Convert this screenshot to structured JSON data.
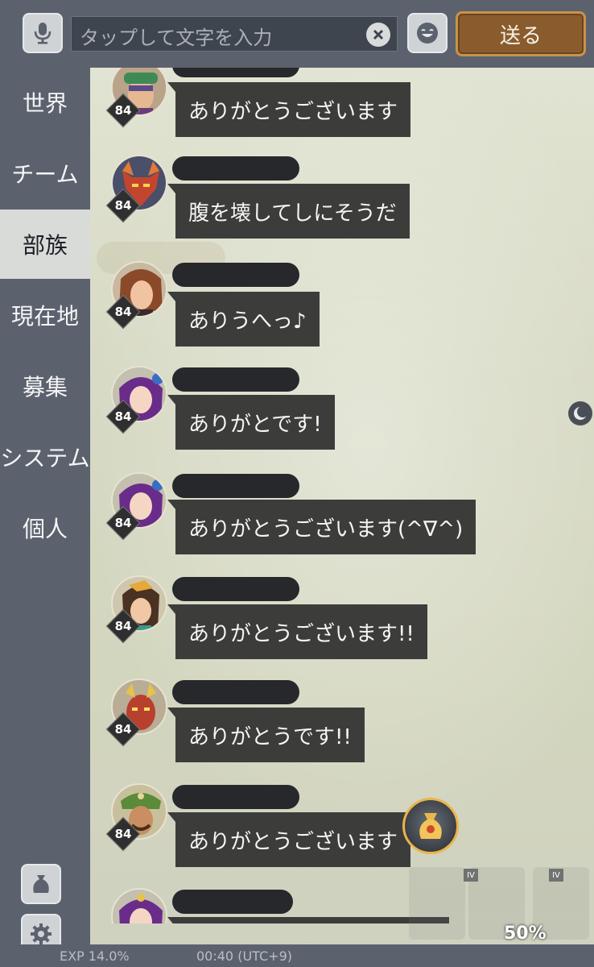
{
  "header": {
    "input_placeholder": "タップして文字を入力",
    "send_label": "送る"
  },
  "sidebar": {
    "tabs": [
      {
        "label": "世界"
      },
      {
        "label": "チーム"
      },
      {
        "label": "部族",
        "active": true
      },
      {
        "label": "現在地"
      },
      {
        "label": "募集"
      },
      {
        "label": "システム"
      },
      {
        "label": "個人"
      }
    ]
  },
  "messages": [
    {
      "level": "84",
      "text": "ありがとうございます",
      "avatar": "green-helmet-avatar"
    },
    {
      "level": "84",
      "text": "腹を壊してしにそうだ",
      "avatar": "red-demon-mask-avatar"
    },
    {
      "level": "84",
      "text": "ありうへっ♪",
      "avatar": "brown-hair-girl-avatar"
    },
    {
      "level": "84",
      "text": "ありがとです!",
      "avatar": "purple-hair-girl-avatar"
    },
    {
      "level": "84",
      "text": "ありがとうございます(^∇^)",
      "avatar": "purple-hair-girl-avatar"
    },
    {
      "level": "84",
      "text": "ありがとうございます!!",
      "avatar": "bird-hat-girl-avatar"
    },
    {
      "level": "84",
      "text": "ありがとうです!!",
      "avatar": "red-horned-warrior-avatar"
    },
    {
      "level": "84",
      "text": "ありがとうございます",
      "avatar": "green-hat-warrior-avatar"
    },
    {
      "level": "",
      "text": "",
      "avatar": "purple-hair-girl-avatar"
    }
  ],
  "status": {
    "exp": "EXP 14.0%",
    "time": "00:40 (UTC+9)",
    "percent": "50%"
  },
  "colors": {
    "panel": "#5b626e",
    "bubble": "#3c3d3b",
    "send_button": "#8a5c2d",
    "active_tab": "#d9dbd8"
  }
}
